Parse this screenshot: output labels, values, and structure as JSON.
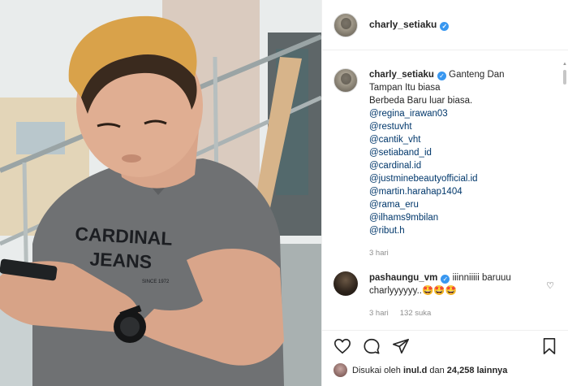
{
  "post": {
    "username": "charly_setiaku",
    "verified_icon": "verified-badge-icon"
  },
  "caption": {
    "username": "charly_setiaku",
    "lines": [
      "Ganteng Dan",
      "Tampan Itu biasa",
      "Berbeda Baru luar biasa."
    ],
    "mentions": [
      "@regina_irawan03",
      "@restuvht",
      "@cantik_vht",
      "@setiaband_id",
      "@cardinal.id",
      "@justminebeautyofficial.id",
      "@martin.harahap1404",
      "@rama_eru",
      "@ilhams9mbilan",
      "@ribut.h"
    ],
    "time": "3 hari"
  },
  "reply": {
    "username": "pashaungu_vm",
    "text_line1": "iiinniiiii",
    "text_line2": "baruuu charlyyyyyy..🤩🤩🤩",
    "time": "3 hari",
    "likes": "132 suka"
  },
  "likes_line": {
    "prefix": "Disukai oleh",
    "user": "inul.d",
    "middle": "dan",
    "count": "24,258 lainnya"
  },
  "photo": {
    "shirt_text_1": "CARDINAL",
    "shirt_text_2": "JEANS",
    "shirt_text_3": "SINCE 1972"
  },
  "colors": {
    "link": "#00376b",
    "verified": "#3897f0",
    "meta": "#8e8e8e"
  }
}
